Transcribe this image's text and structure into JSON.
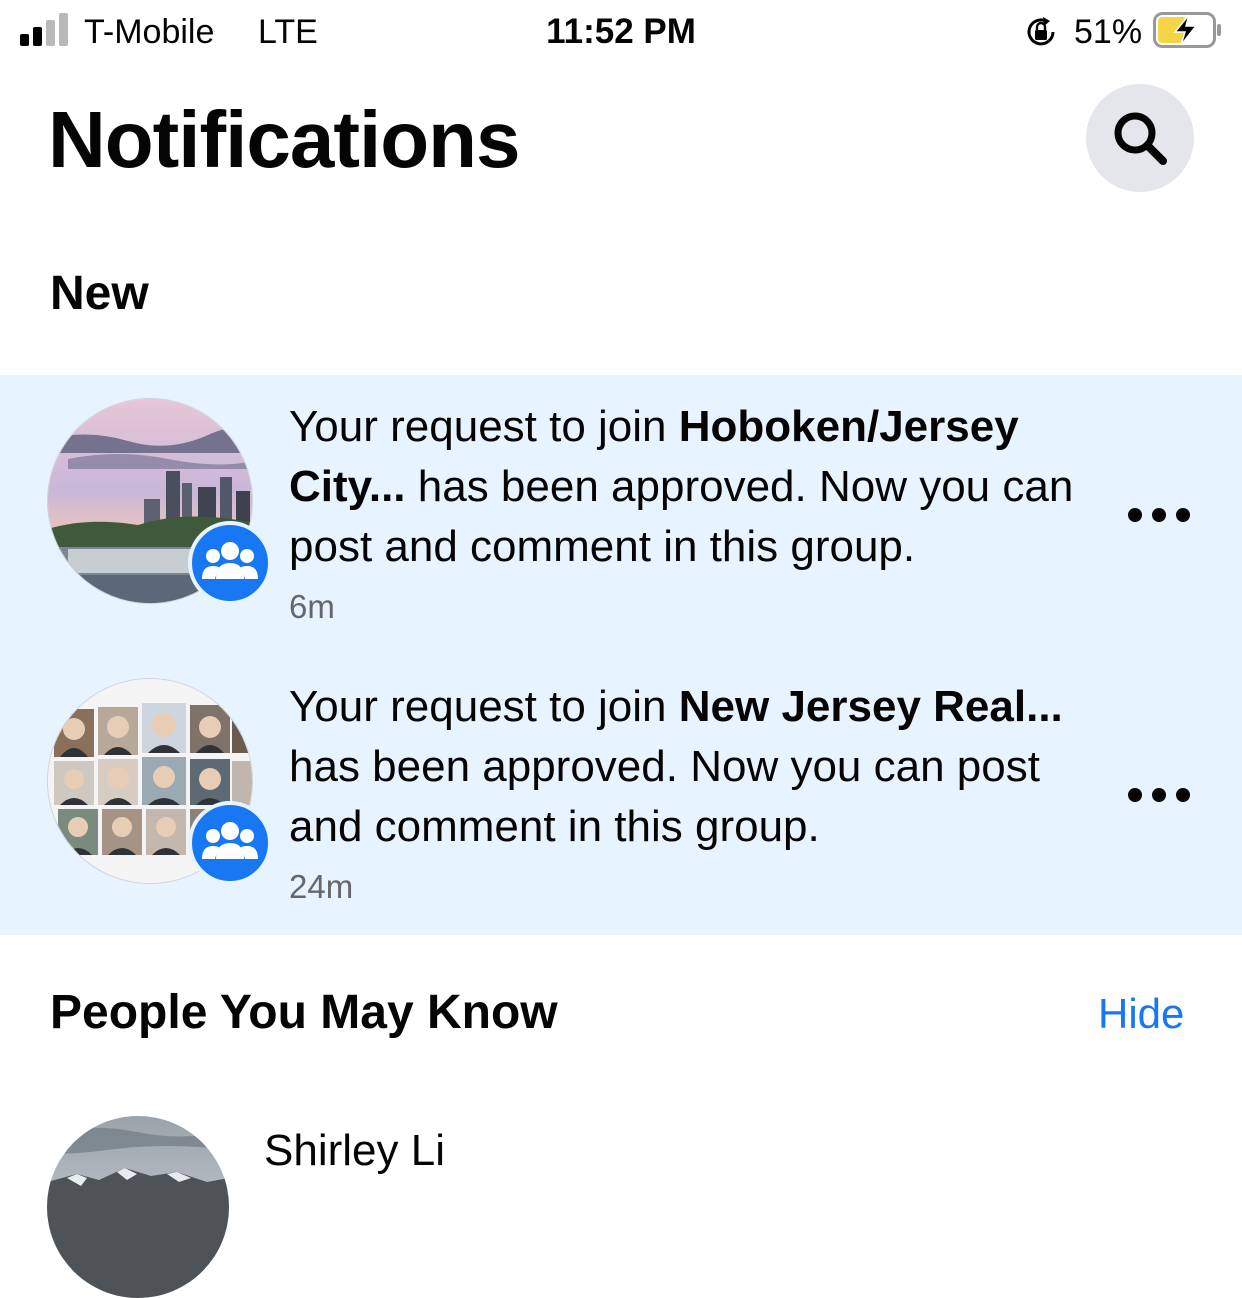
{
  "status_bar": {
    "carrier": "T-Mobile",
    "network": "LTE",
    "time": "11:52 PM",
    "battery_percent": "51%",
    "signal_bars_filled": 2,
    "signal_bars_total": 4,
    "battery_level": 0.51,
    "battery_charging": true,
    "icons": [
      "signal-icon",
      "rotation-lock-icon",
      "battery-charging-icon"
    ]
  },
  "header": {
    "title": "Notifications",
    "search_icon": "search-icon"
  },
  "sections": {
    "new_label": "New",
    "people_label": "People You May Know",
    "hide_label": "Hide"
  },
  "notifications": [
    {
      "prefix": "Your request to join ",
      "group": "Hoboken/Jersey City...",
      "suffix": " has been approved. Now you can post and comment in this group.",
      "time": "6m",
      "badge_icon": "group-icon",
      "more_icon": "more-options-icon"
    },
    {
      "prefix": "Your request to join ",
      "group": "New Jersey Real...",
      "suffix": " has been approved. Now you can post and comment in this group.",
      "time": "24m",
      "badge_icon": "group-icon",
      "more_icon": "more-options-icon"
    }
  ],
  "people": [
    {
      "name": "Shirley Li"
    }
  ],
  "colors": {
    "accent": "#1877f2",
    "unread_bg": "#e7f3ff",
    "secondary_text": "#65676b",
    "search_bg": "#e4e6eb",
    "battery_fill": "#f5d547"
  }
}
